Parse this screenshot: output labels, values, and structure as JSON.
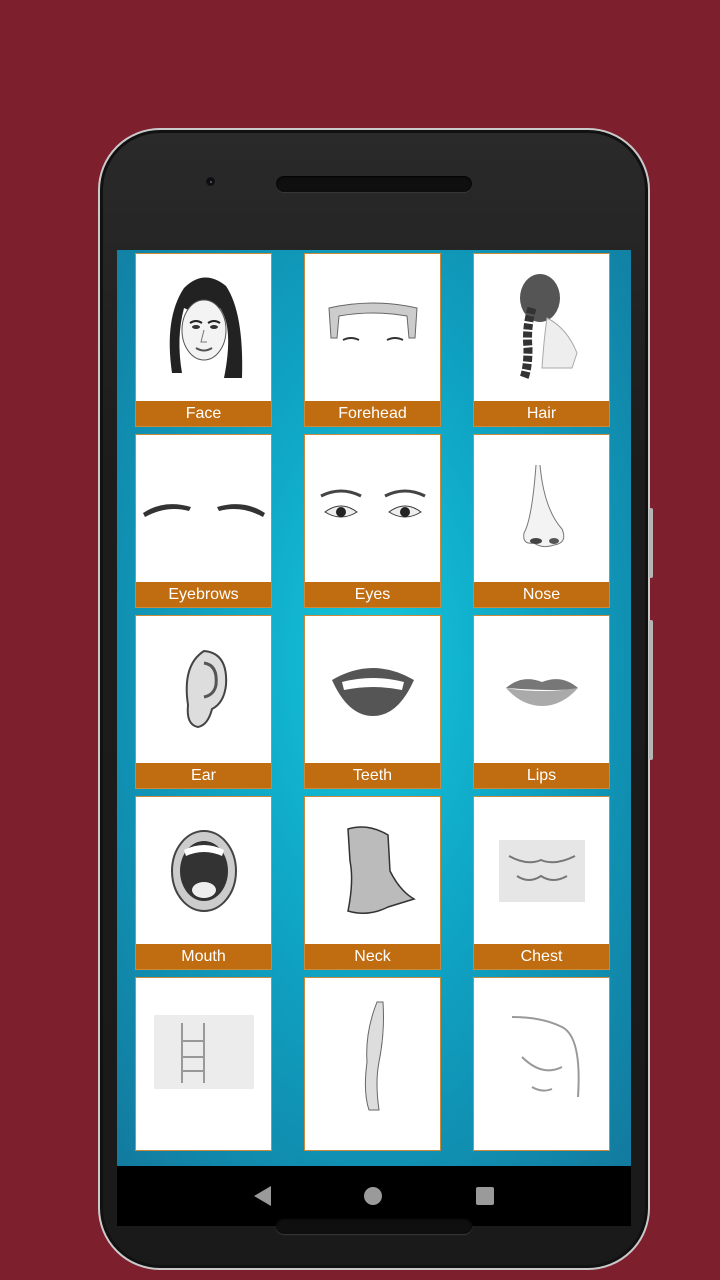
{
  "app": {
    "categories": [
      {
        "label": "Face",
        "icon": "face-sketch-icon"
      },
      {
        "label": "Forehead",
        "icon": "forehead-sketch-icon"
      },
      {
        "label": "Hair",
        "icon": "hair-braid-sketch-icon"
      },
      {
        "label": "Eyebrows",
        "icon": "eyebrows-sketch-icon"
      },
      {
        "label": "Eyes",
        "icon": "eyes-sketch-icon"
      },
      {
        "label": "Nose",
        "icon": "nose-sketch-icon"
      },
      {
        "label": "Ear",
        "icon": "ear-sketch-icon"
      },
      {
        "label": "Teeth",
        "icon": "teeth-sketch-icon"
      },
      {
        "label": "Lips",
        "icon": "lips-sketch-icon"
      },
      {
        "label": "Mouth",
        "icon": "mouth-sketch-icon"
      },
      {
        "label": "Neck",
        "icon": "neck-sketch-icon"
      },
      {
        "label": "Chest",
        "icon": "chest-sketch-icon"
      },
      {
        "label": "",
        "icon": "abs-sketch-icon"
      },
      {
        "label": "",
        "icon": "arm-sketch-icon"
      },
      {
        "label": "",
        "icon": "shoulder-sketch-icon"
      }
    ]
  },
  "navigation": {
    "back": "back-icon",
    "home": "home-icon",
    "recents": "recents-icon"
  },
  "colors": {
    "background": "#7e1f2d",
    "label_bar": "#c06c10",
    "screen_bg": "#14c6dc"
  }
}
